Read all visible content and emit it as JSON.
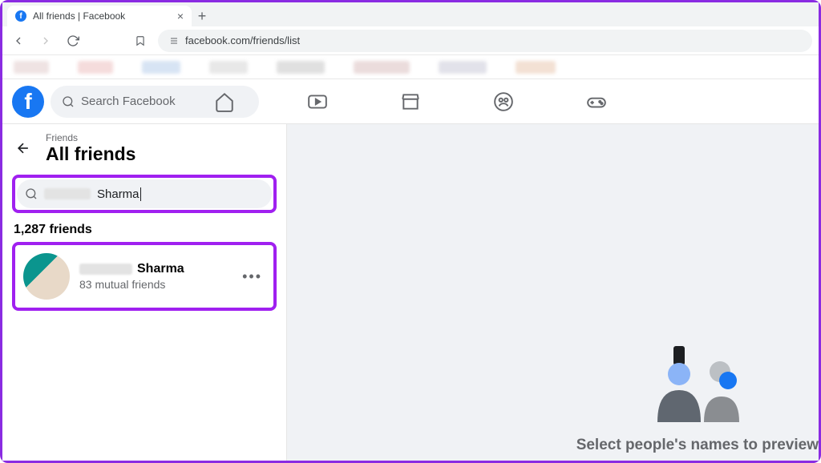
{
  "browser": {
    "tab_title": "All friends | Facebook",
    "url": "facebook.com/friends/list"
  },
  "fb": {
    "search_placeholder": "Search Facebook"
  },
  "sidebar": {
    "breadcrumb": "Friends",
    "title": "All friends",
    "search_value": "Sharma",
    "friend_count": "1,287 friends",
    "friends": [
      {
        "name_visible": "Sharma",
        "subtext": "83 mutual friends"
      }
    ]
  },
  "main": {
    "placeholder_text": "Select people's names to preview"
  }
}
